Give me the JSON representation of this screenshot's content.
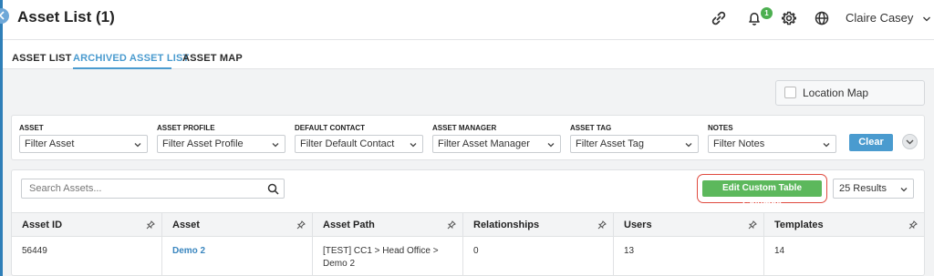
{
  "header": {
    "title": "Asset List (1)",
    "notification_count": "1",
    "user_name": "Claire Casey"
  },
  "tabs": [
    {
      "label": "ASSET LIST"
    },
    {
      "label": "ARCHIVED ASSET LIST"
    },
    {
      "label": "ASSET MAP"
    }
  ],
  "location_map": {
    "label": "Location Map"
  },
  "filters": [
    {
      "label": "ASSET",
      "value": "Filter Asset"
    },
    {
      "label": "ASSET PROFILE",
      "value": "Filter Asset Profile"
    },
    {
      "label": "DEFAULT CONTACT",
      "value": "Filter Default Contact"
    },
    {
      "label": "ASSET MANAGER",
      "value": "Filter Asset Manager"
    },
    {
      "label": "ASSET TAG",
      "value": "Filter Asset Tag"
    },
    {
      "label": "NOTES",
      "value": "Filter Notes"
    }
  ],
  "clear_label": "Clear",
  "table": {
    "search_placeholder": "Search Assets...",
    "edit_columns_label": "Edit Custom Table Columns",
    "results_label": "25 Results",
    "columns": [
      "Asset ID",
      "Asset",
      "Asset Path",
      "Relationships",
      "Users",
      "Templates"
    ],
    "rows": [
      {
        "asset_id": "56449",
        "asset": "Demo 2",
        "asset_path": "[TEST] CC1 > Head Office > Demo 2",
        "relationships": "0",
        "users": "13",
        "templates": "14"
      }
    ]
  },
  "colors": {
    "accent": "#4a9bcf",
    "success": "#5cb85c",
    "highlight": "#e04a3f"
  }
}
